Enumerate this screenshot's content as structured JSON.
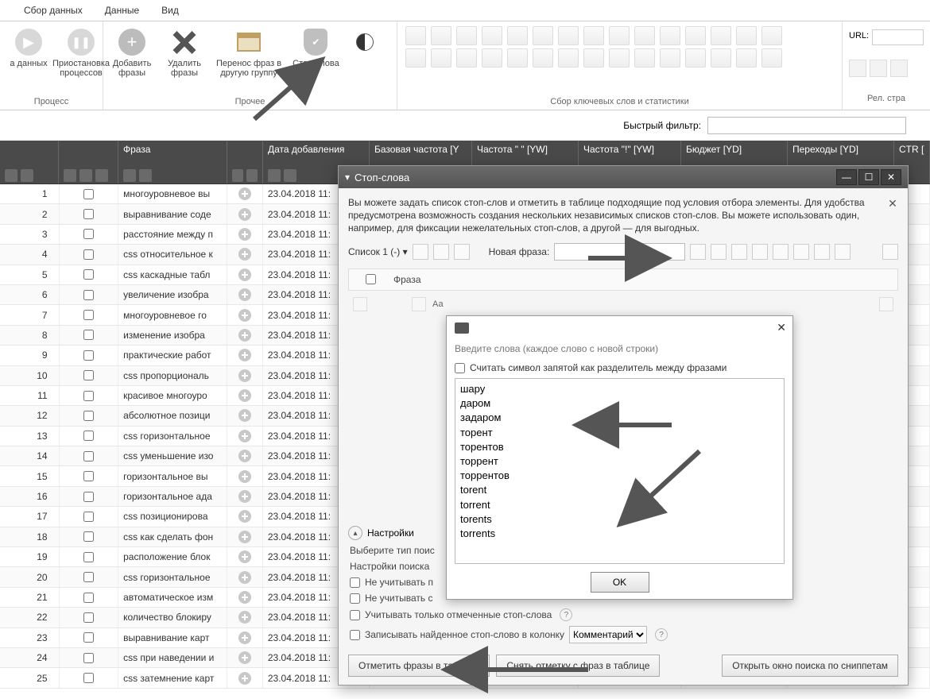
{
  "menu": {
    "items": [
      "Сбор данных",
      "Данные",
      "Вид"
    ]
  },
  "ribbon": {
    "process": {
      "caption": "Процесс",
      "collect": "а данных",
      "pause": "Приостановка\nпроцессов"
    },
    "other": {
      "caption": "Прочее",
      "add": "Добавить\nфразы",
      "del": "Удалить\nфразы",
      "move": "Перенос фраз в\nдругую группу",
      "stop": "Стоп-слова"
    },
    "keywords_caption": "Сбор ключевых слов и статистики",
    "url_label": "URL:",
    "rel_caption": "Рел. стра"
  },
  "quick_filter": {
    "label": "Быстрый фильтр:",
    "value": ""
  },
  "columns": {
    "phrase": "Фраза",
    "date": "Дата добавления",
    "base": "Базовая частота [Y",
    "f1": "Частота \" \" [YW]",
    "f2": "Частота \"!\" [YW]",
    "budget": "Бюджет [YD]",
    "clicks": "Переходы [YD]",
    "ctr": "CTR [Y"
  },
  "rows": [
    {
      "phrase": "многоуровневое вы",
      "date": "23.04.2018 11:"
    },
    {
      "phrase": "выравнивание соде",
      "date": "23.04.2018 11:"
    },
    {
      "phrase": "расстояние между п",
      "date": "23.04.2018 11:"
    },
    {
      "phrase": "css относительное к",
      "date": "23.04.2018 11:"
    },
    {
      "phrase": "css каскадные табл",
      "date": "23.04.2018 11:"
    },
    {
      "phrase": "увеличение изобра",
      "date": "23.04.2018 11:"
    },
    {
      "phrase": "многоуровневое го",
      "date": "23.04.2018 11:"
    },
    {
      "phrase": "изменение изобра",
      "date": "23.04.2018 11:"
    },
    {
      "phrase": "практические работ",
      "date": "23.04.2018 11:"
    },
    {
      "phrase": "css пропорциональ",
      "date": "23.04.2018 11:"
    },
    {
      "phrase": "красивое многоуро",
      "date": "23.04.2018 11:"
    },
    {
      "phrase": "абсолютное позици",
      "date": "23.04.2018 11:"
    },
    {
      "phrase": "css горизонтальное",
      "date": "23.04.2018 11:"
    },
    {
      "phrase": "css уменьшение изо",
      "date": "23.04.2018 11:"
    },
    {
      "phrase": "горизонтальное вы",
      "date": "23.04.2018 11:"
    },
    {
      "phrase": "горизонтальное ада",
      "date": "23.04.2018 11:"
    },
    {
      "phrase": "css позиционирова",
      "date": "23.04.2018 11:"
    },
    {
      "phrase": "css как сделать фон",
      "date": "23.04.2018 11:"
    },
    {
      "phrase": "расположение блок",
      "date": "23.04.2018 11:"
    },
    {
      "phrase": "css горизонтальное",
      "date": "23.04.2018 11:"
    },
    {
      "phrase": "автоматическое изм",
      "date": "23.04.2018 11:"
    },
    {
      "phrase": "количество блокиру",
      "date": "23.04.2018 11:"
    },
    {
      "phrase": "выравнивание карт",
      "date": "23.04.2018 11:"
    },
    {
      "phrase": "css при наведении и",
      "date": "23.04.2018 11:"
    },
    {
      "phrase": "css затемнение карт",
      "date": "23.04.2018 11:"
    }
  ],
  "dialog": {
    "title": "Стоп-слова",
    "intro": "Вы можете задать список стоп-слов и отметить в таблице подходящие под условия отбора элементы. Для удобства предусмотрена возможность создания нескольких независимых списков стоп-слов. Вы можете использовать один, например, для фиксации нежелательных стоп-слов, а другой — для выгодных.",
    "list_label": "Список 1 (-) ▾",
    "new_phrase_label": "Новая фраза:",
    "new_phrase_value": "",
    "col_phrase": "Фраза",
    "settings": {
      "title": "Настройки",
      "search_type": "Выберите тип поис",
      "search_settings": "Настройки поиска",
      "ignore1": "Не учитывать п",
      "ignore2": "Не учитывать с",
      "only_marked": "Учитывать только отмеченные стоп-слова",
      "write_to_col": "Записывать найденное стоп-слово в колонку",
      "col_select": "Комментарий"
    },
    "buttons": {
      "mark": "Отметить фразы в таблице",
      "unmark": "Снять отметку с фраз в таблице",
      "snippet": "Открыть окно поиска по сниппетам"
    }
  },
  "popup": {
    "hint": "Введите слова (каждое слово с новой строки)",
    "comma_check": "Считать символ запятой как разделитель между фразами",
    "text": "шару\nдаром\nзадаром\nторент\nторентов\nторрент\nторрентов\ntorent\ntorrent\ntorents\ntorrents",
    "ok": "OK"
  }
}
